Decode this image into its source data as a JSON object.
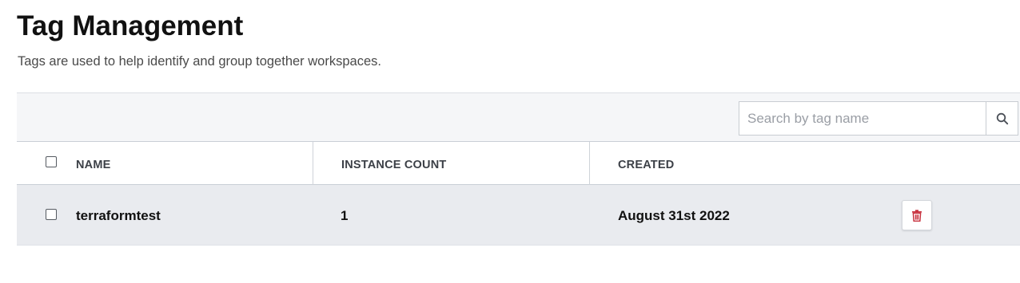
{
  "page": {
    "title": "Tag Management",
    "subtitle": "Tags are used to help identify and group together workspaces."
  },
  "search": {
    "placeholder": "Search by tag name",
    "value": "",
    "icon": "search-icon"
  },
  "table": {
    "columns": [
      {
        "label": "NAME"
      },
      {
        "label": "INSTANCE COUNT"
      },
      {
        "label": "CREATED"
      }
    ],
    "rows": [
      {
        "name": "terraformtest",
        "instance_count": "1",
        "created": "August 31st 2022",
        "checked": false,
        "action_icon": "trash-icon"
      }
    ],
    "select_all_checked": false
  },
  "colors": {
    "delete_icon": "#c8323f",
    "row_background": "#e9ebef",
    "toolbar_background": "#f5f6f8"
  }
}
